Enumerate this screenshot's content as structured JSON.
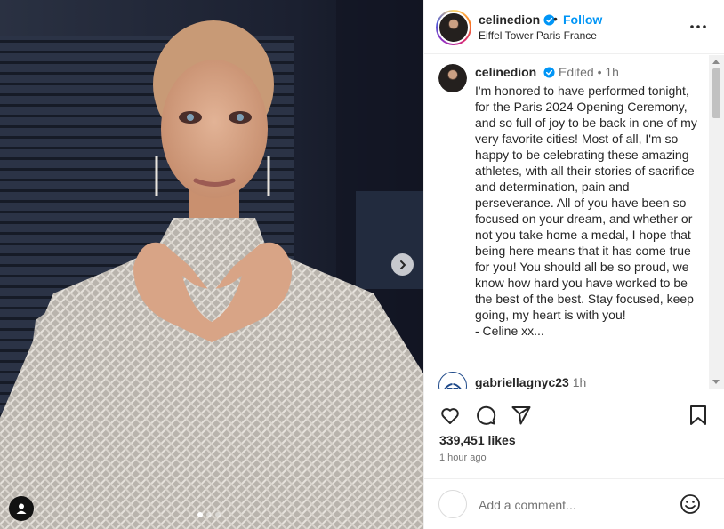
{
  "post": {
    "username": "celinedion",
    "follow_label": "Follow",
    "separator": "•",
    "location": "Eiffel Tower Paris France"
  },
  "caption": {
    "username": "celinedion",
    "meta": "Edited • 1h",
    "text": "I'm honored to have performed tonight, for the Paris 2024 Opening Ceremony, and so full of joy to be back in one of my very favorite cities! Most of all, I'm so happy to be celebrating these amazing athletes, with all their stories of sacrifice and determination, pain and perseverance. All of you have been so focused on your dream, and whether or not you take home a medal, I hope that being here means that it has come true for you! You should all be so proud, we know how hard you have worked to be the best of the best. Stay focused, keep going, my heart is with you!\n- Celine xx..."
  },
  "comments": [
    {
      "username": "gabriellagnyc23",
      "time": "1h"
    }
  ],
  "stats": {
    "likes": "339,451 likes",
    "time_ago": "1 hour ago"
  },
  "composer": {
    "placeholder": "Add a comment..."
  },
  "carousel": {
    "count": 3,
    "active_index": 0
  },
  "icons": {
    "verified": "verified-badge-icon",
    "more": "more-options-icon",
    "like": "heart-icon",
    "comment": "comment-bubble-icon",
    "share": "paper-plane-icon",
    "save": "bookmark-icon",
    "emoji": "emoji-smile-icon",
    "next": "chevron-right-icon",
    "tag": "user-tag-icon"
  },
  "colors": {
    "accent": "#0095f6",
    "text": "#262626",
    "muted": "#737373"
  }
}
